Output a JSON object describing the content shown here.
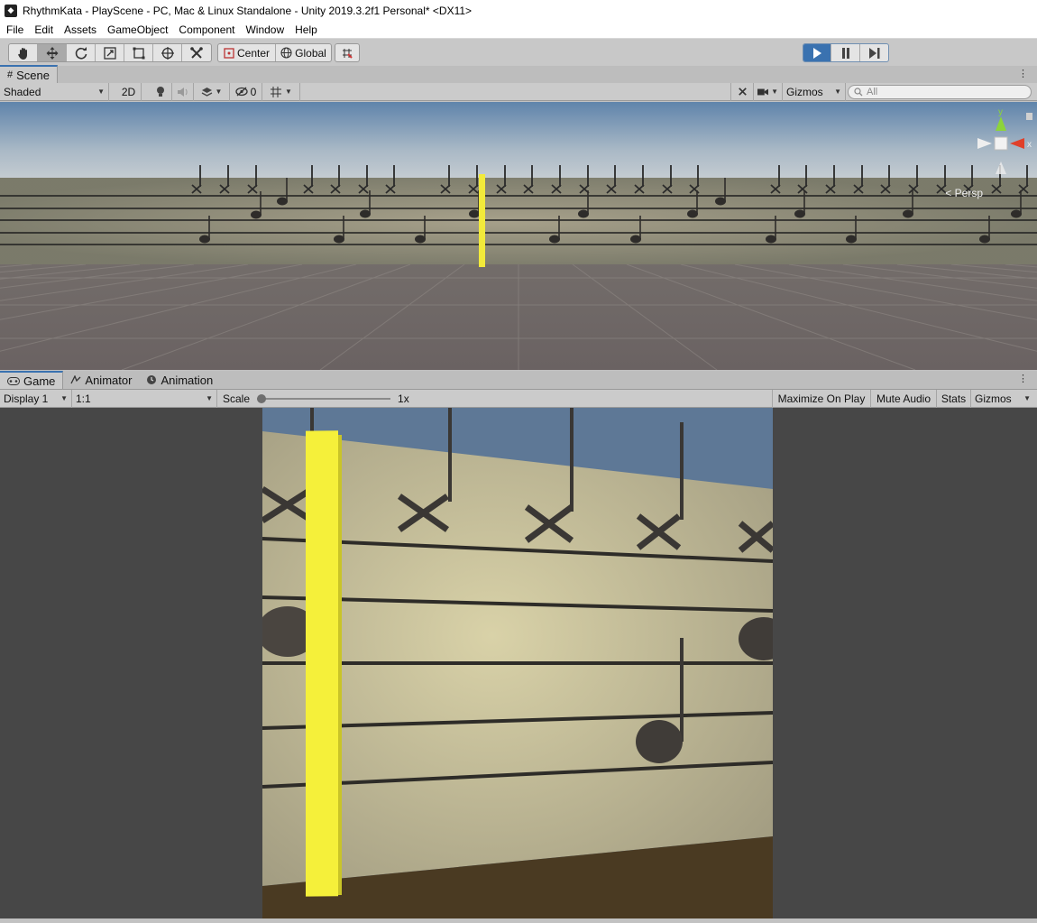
{
  "window": {
    "title": "RhythmKata - PlayScene - PC, Mac & Linux Standalone - Unity 2019.3.2f1 Personal* <DX11>"
  },
  "menu": [
    "File",
    "Edit",
    "Assets",
    "GameObject",
    "Component",
    "Window",
    "Help"
  ],
  "toolbar": {
    "pivot_label": "Center",
    "space_label": "Global",
    "tools": [
      "hand-tool",
      "move-tool",
      "rotate-tool",
      "scale-tool",
      "rect-tool",
      "transform-tool",
      "custom-tool"
    ]
  },
  "scene_panel": {
    "tab_label": "Scene",
    "shading_mode": "Shaded",
    "mode_2d": "2D",
    "hidden_count": "0",
    "gizmos_label": "Gizmos",
    "search_placeholder": "All",
    "persp_label": "< Persp",
    "axis_y": "y",
    "axis_x": "x"
  },
  "game_panel": {
    "tabs": [
      "Game",
      "Animator",
      "Animation"
    ],
    "display": "Display 1",
    "aspect": "1:1",
    "scale_label": "Scale",
    "scale_value": "1x",
    "maximize_on_play": "Maximize On Play",
    "mute_audio": "Mute Audio",
    "stats": "Stats",
    "gizmos_label": "Gizmos"
  },
  "colors": {
    "accent": "#3a72b0",
    "playhead": "#f5f03a",
    "sky_top": "#5e7896",
    "staff_board": "#d6cfa6",
    "ground": "#4a3a22",
    "scene_ground": "#6e6866"
  }
}
